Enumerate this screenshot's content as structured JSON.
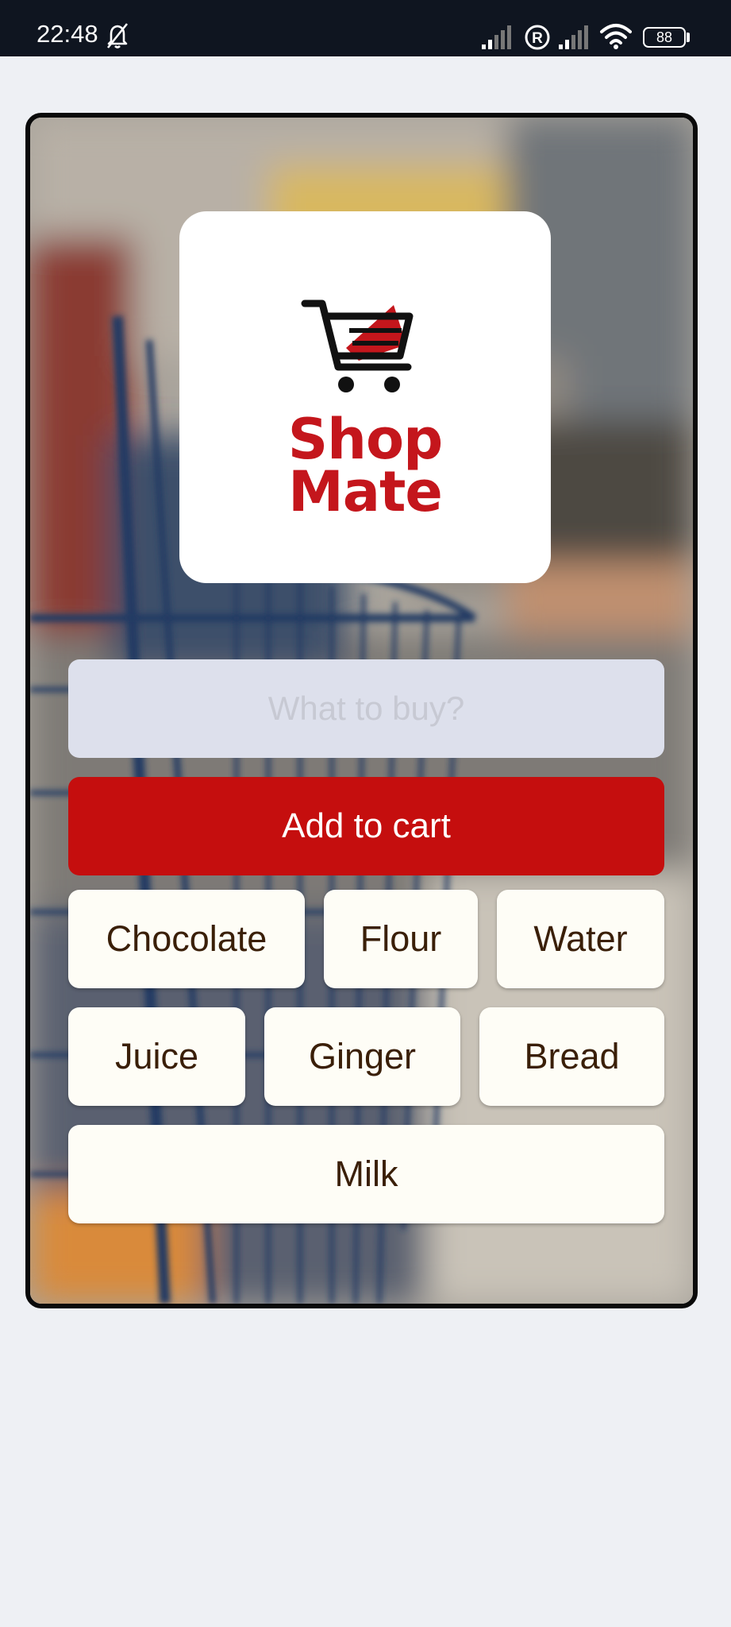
{
  "status_bar": {
    "time": "22:48",
    "battery": "88",
    "icons": [
      "bell-off-icon",
      "signal-icon",
      "roaming-r-icon",
      "signal-icon",
      "wifi-icon",
      "battery-icon"
    ]
  },
  "logo": {
    "line1": "Shop",
    "line2": "Mate",
    "icon": "shopping-cart-icon",
    "color": "#c4161c"
  },
  "search": {
    "placeholder": "What to buy?",
    "value": ""
  },
  "add_button": {
    "label": "Add to cart",
    "color": "#c50e0e"
  },
  "items": [
    "Chocolate",
    "Flour",
    "Water",
    "Juice",
    "Ginger",
    "Bread",
    "Milk"
  ],
  "colors": {
    "page_background": "#eef0f4",
    "status_bar": "#0f1520",
    "chip_background": "#fefdf6",
    "chip_text": "#3a1f08",
    "input_background": "#dde0ec"
  }
}
